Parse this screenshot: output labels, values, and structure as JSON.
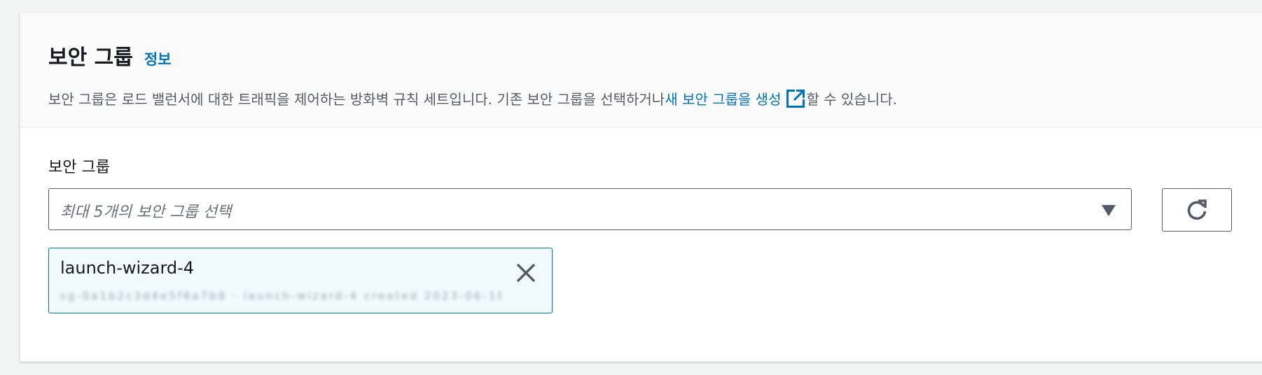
{
  "security_groups": {
    "title": "보안 그룹",
    "info_link": "정보",
    "description_before": "보안 그룹은 로드 밸런서에 대한 트래픽을 제어하는 방화벽 규칙 세트입니다. 기존 보안 그룹을 선택하거나 ",
    "create_link": "새 보안 그룹을 생성",
    "description_after": "할 수 있습니다.",
    "field_label": "보안 그룹",
    "select_placeholder": "최대 5개의 보안 그룹 선택",
    "selected": [
      {
        "name": "launch-wizard-4",
        "description": "sg-0a1b2c3d4e5f6a7b8 · launch-wizard-4 created 2023-06-18T00:00:00Z"
      }
    ]
  },
  "icons": {
    "external_link": "external-link-icon",
    "dropdown_caret": "caret-down-icon",
    "refresh": "refresh-icon",
    "remove": "close-icon"
  },
  "colors": {
    "link": "#0073bb",
    "token_background": "#f1faff",
    "token_border": "#0073bb",
    "text_primary": "#16191f",
    "text_secondary": "#545b64",
    "header_background": "#fafafa"
  }
}
